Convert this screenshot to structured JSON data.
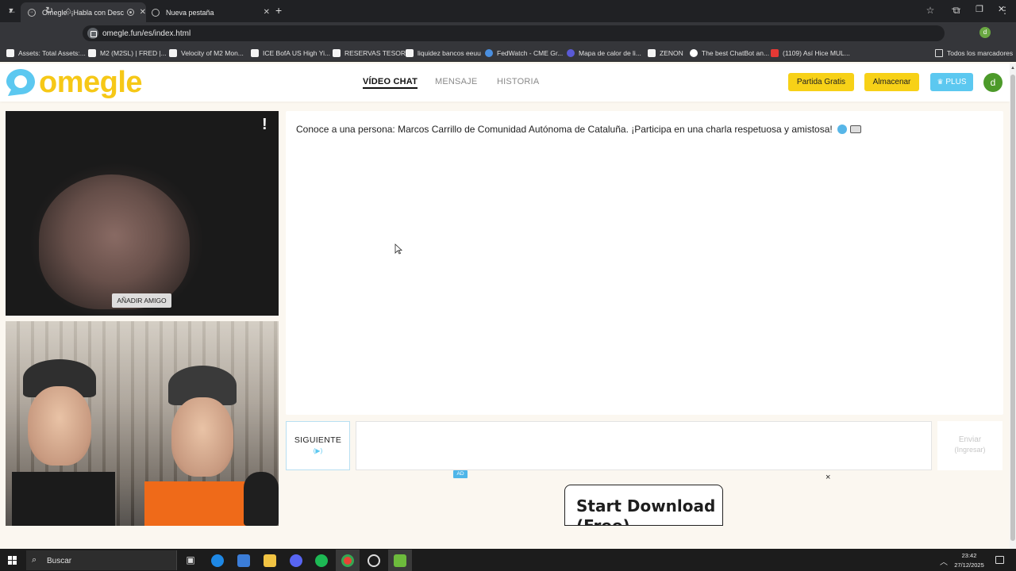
{
  "browser": {
    "tabs": [
      {
        "title": "Omegle: ¡Habla con Descon",
        "active": true
      },
      {
        "title": "Nueva pestaña",
        "active": false
      }
    ],
    "url": "omegle.fun/es/index.html",
    "profile_initial": "d",
    "bookmarks": [
      {
        "label": "Assets: Total Assets:...",
        "icon": "doc-icon"
      },
      {
        "label": "M2 (M2SL) | FRED |...",
        "icon": "doc-icon"
      },
      {
        "label": "Velocity of M2 Mon...",
        "icon": "doc-icon"
      },
      {
        "label": "ICE BofA US High Yi...",
        "icon": "doc-icon"
      },
      {
        "label": "RESERVAS TESORO",
        "icon": "doc-icon"
      },
      {
        "label": "liquidez bancos eeuu",
        "icon": "doc-icon"
      },
      {
        "label": "FedWatch - CME Gr...",
        "icon": "globe-icon"
      },
      {
        "label": "Mapa de calor de li...",
        "icon": "b-icon"
      },
      {
        "label": "ZENON",
        "icon": "doc-icon"
      },
      {
        "label": "The best ChatBot an...",
        "icon": "diamond-icon"
      },
      {
        "label": "(1109) Así Hice MUL...",
        "icon": "youtube-icon"
      },
      {
        "label": "Todos los marcadores",
        "icon": "folder-icon"
      }
    ]
  },
  "site": {
    "logo_text": "omegle",
    "nav": [
      {
        "label": "VÍDEO CHAT",
        "active": true
      },
      {
        "label": "MENSAJE",
        "active": false
      },
      {
        "label": "HISTORIA",
        "active": false
      }
    ],
    "buttons": {
      "free_game": "Partida Gratis",
      "store": "Almacenar",
      "plus": "PLUS"
    },
    "user_initial": "d",
    "colors": {
      "brand": "#f6c817",
      "accent_blue": "#5cc8f0",
      "button_yellow": "#f7d117"
    }
  },
  "video": {
    "report_symbol": "!",
    "add_friend": "AÑADIR AMIGO"
  },
  "chat": {
    "message": "Conoce a una persona: Marcos Carrillo de Comunidad Autónoma de Cataluña. ¡Participa en una charla respetuosa y amistosa!",
    "next_label": "SIGUIENTE",
    "next_hint": "(▶)",
    "input_value": "",
    "send_label": "Enviar",
    "send_hint": "(Ingresar)"
  },
  "ad": {
    "badge": "AD",
    "close": "×",
    "text": "Start Download (Free)"
  },
  "taskbar": {
    "search_placeholder": "Buscar",
    "time": "23:42",
    "date": "27/12/2025"
  }
}
